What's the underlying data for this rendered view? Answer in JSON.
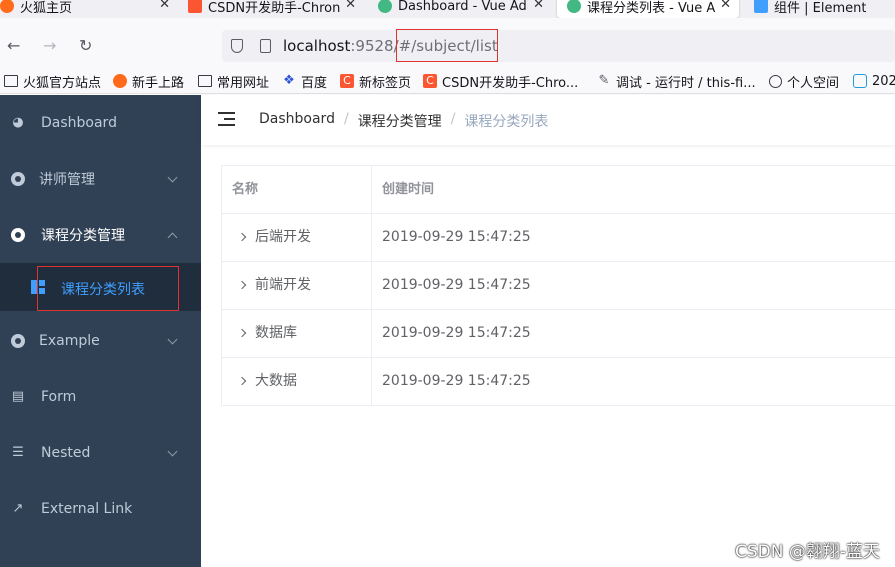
{
  "browser": {
    "tabs": [
      {
        "title": "火狐主页",
        "active": false
      },
      {
        "title": "CSDN开发助手-Chron",
        "active": false
      },
      {
        "title": "Dashboard - Vue Adi",
        "active": false
      },
      {
        "title": "课程分类列表 - Vue A",
        "active": true
      },
      {
        "title": "组件 | Element",
        "active": false
      }
    ],
    "url_host": "localhost",
    "url_rest": ":9528/#/subject/list",
    "bookmarks": [
      {
        "label": "火狐官方站点",
        "icon": "folder-icon"
      },
      {
        "label": "新手上路",
        "icon": "firefox-icon"
      },
      {
        "label": "常用网址",
        "icon": "folder-icon"
      },
      {
        "label": "百度",
        "icon": "baidu-paw-icon"
      },
      {
        "label": "新标签页",
        "icon": "csdn-icon"
      },
      {
        "label": "CSDN开发助手-Chro...",
        "icon": "csdn-icon"
      },
      {
        "label": "调试 - 运行时 / this-fi...",
        "icon": "wrench-icon"
      },
      {
        "label": "个人空间",
        "icon": "globe-icon"
      },
      {
        "label": "202",
        "icon": "bilibili-icon"
      }
    ]
  },
  "sidebar": {
    "items": [
      {
        "label": "Dashboard",
        "icon": "dashboard-icon",
        "has_children": false
      },
      {
        "label": "讲师管理",
        "icon": "circle-icon",
        "has_children": true
      },
      {
        "label": "课程分类管理",
        "icon": "circle-icon",
        "has_children": true,
        "opened": true
      },
      {
        "label": "Example",
        "icon": "circle-icon",
        "has_children": true
      },
      {
        "label": "Form",
        "icon": "form-icon",
        "has_children": false
      },
      {
        "label": "Nested",
        "icon": "nested-list-icon",
        "has_children": true
      },
      {
        "label": "External Link",
        "icon": "external-link-icon",
        "has_children": false
      }
    ],
    "active_subitem": {
      "label": "课程分类列表",
      "icon": "table-icon"
    }
  },
  "breadcrumb": [
    "Dashboard",
    "课程分类管理",
    "课程分类列表"
  ],
  "table": {
    "headers": [
      "名称",
      "创建时间"
    ],
    "rows": [
      {
        "name": "后端开发",
        "created": "2019-09-29 15:47:25"
      },
      {
        "name": "前端开发",
        "created": "2019-09-29 15:47:25"
      },
      {
        "name": "数据库",
        "created": "2019-09-29 15:47:25"
      },
      {
        "name": "大数据",
        "created": "2019-09-29 15:47:25"
      }
    ]
  },
  "watermark": "CSDN @翱翔-蓝天",
  "colors": {
    "sidebar_bg": "#304156",
    "submenu_bg": "#1f2d3d",
    "active_blue": "#409eff",
    "highlight_red": "#e0322e"
  }
}
